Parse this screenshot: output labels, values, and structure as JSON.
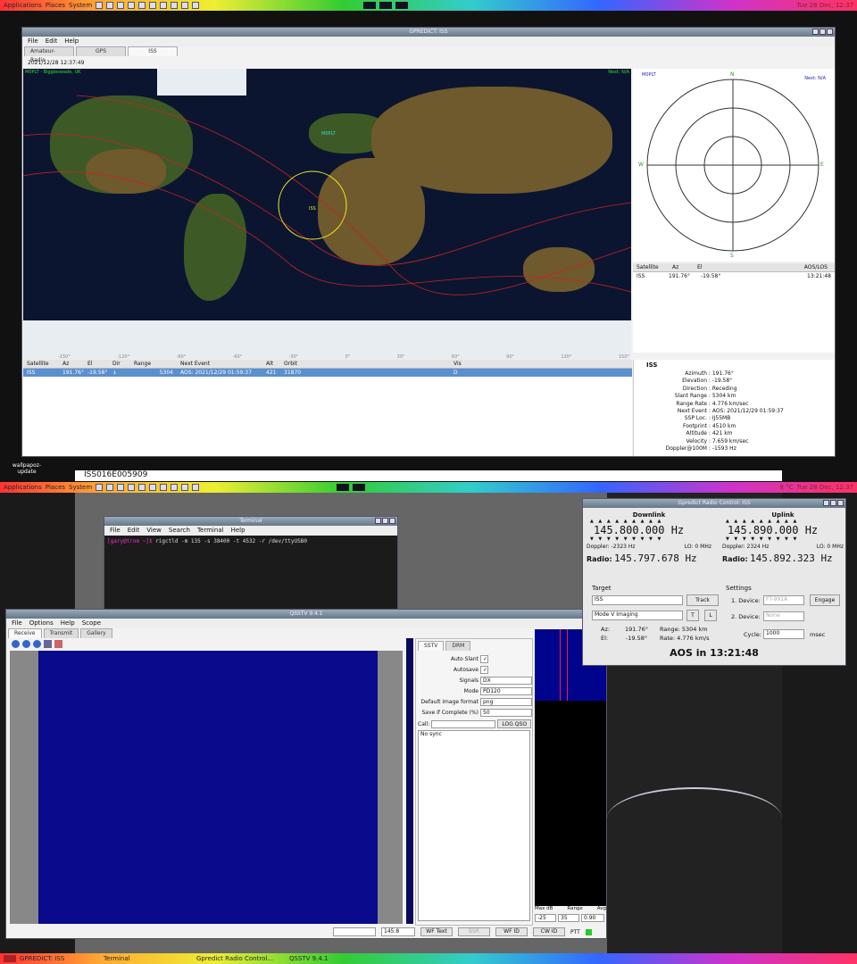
{
  "top_panel": {
    "apps": "Applications",
    "places": "Places",
    "system": "System",
    "clock": "Tue 28 Dec, 12:37"
  },
  "bottom_panel": {
    "apps": "Applications",
    "places": "Places",
    "system": "System",
    "temp": "8 °C",
    "clock": "Tue 28 Dec, 12:37"
  },
  "desktop": {
    "icon_label": "wallpapoz-update",
    "overlay_title": "ISS016E005909"
  },
  "gpredict": {
    "title": "GPREDICT: ISS",
    "menu": [
      "File",
      "Edit",
      "Help"
    ],
    "tabs": [
      "Amateur-Radio",
      "GPS",
      "ISS"
    ],
    "datetime": "2021/12/28 12:37:49",
    "map": {
      "qth": "M0PLT - Biggleswade, UK",
      "next": "Next: N/A",
      "station": "M0PLT",
      "sat": "ISS",
      "lon_ticks": [
        "-150°",
        "-120°",
        "-90°",
        "-60°",
        "-30°",
        "0°",
        "30°",
        "60°",
        "90°",
        "120°",
        "150°"
      ],
      "lat_ticks": [
        "60°",
        "30°",
        "0°",
        "-30°",
        "-60°"
      ]
    },
    "polar": {
      "qth": "M0PLT",
      "next": "Next: N/A",
      "N": "N",
      "S": "S",
      "E": "E",
      "W": "W"
    },
    "polar_table": {
      "headers": [
        "Satellite",
        "Az",
        "El",
        "AOS/LOS"
      ],
      "row": [
        "ISS",
        "191.76°",
        "-19.58°",
        "13:21:48"
      ]
    },
    "list": {
      "headers": [
        "Satellite",
        "Az",
        "El",
        "Dir",
        "Range",
        "Next Event",
        "Alt",
        "Orbit",
        "Vis"
      ],
      "row": [
        "ISS",
        "191.76°",
        "-19.58°",
        "↓",
        "5304",
        "AOS: 2021/12/29 01:59:37",
        "421",
        "31870",
        "D"
      ]
    },
    "details": {
      "title": "ISS",
      "rows": [
        [
          "Azimuth",
          "191.76°"
        ],
        [
          "Elevation",
          "-19.58°"
        ],
        [
          "Direction",
          "Receding"
        ],
        [
          "Slant Range",
          "5304 km"
        ],
        [
          "Range Rate",
          "4.776 km/sec"
        ],
        [
          "Next Event",
          "AOS: 2021/12/29 01:59:37"
        ],
        [
          "SSP Loc.",
          "IJ55MB"
        ],
        [
          "Footprint",
          "4510 km"
        ],
        [
          "Altitude",
          "421 km"
        ],
        [
          "Velocity",
          "7.659 km/sec"
        ],
        [
          "Doppler@100M",
          "-1593 Hz"
        ]
      ]
    }
  },
  "terminal": {
    "title": "Terminal",
    "menu": [
      "File",
      "Edit",
      "View",
      "Search",
      "Terminal",
      "Help"
    ],
    "prompt": "[gary@trom ~]$",
    "command": " rigctld -m 135 -s 38400 -t 4532 -r /dev/ttyUSB0"
  },
  "qsstv": {
    "title": "QSSTV 9.4.1",
    "menu": [
      "File",
      "Options",
      "Help",
      "Scope"
    ],
    "tabs": [
      "Receive",
      "Transmit",
      "Gallery"
    ],
    "side_tabs": [
      "SSTV",
      "DRM"
    ],
    "settings": [
      [
        "Auto Slant",
        "✓"
      ],
      [
        "Autosave",
        "✓"
      ],
      [
        "Signals",
        "DX"
      ],
      [
        "Mode",
        "PD120"
      ],
      [
        "Default image format",
        "png"
      ],
      [
        "Save if Complete (%)",
        "50"
      ]
    ],
    "call_label": "Call:",
    "log_qso": "LOG QSO",
    "status": "No sync",
    "freq": "145.8",
    "wf_text": "WF Text",
    "bsr": "BSR",
    "wf_id": "WF ID",
    "cw_id": "CW ID",
    "ptt": "PTT",
    "scope": {
      "max_db_label": "Max dB",
      "range_label": "Range",
      "avg_label": "Avg",
      "max_db": "-25",
      "range": "35",
      "avg": "0.90"
    }
  },
  "radio": {
    "title": "Gpredict Radio Control: ISS",
    "downlink": {
      "title": "Downlink",
      "freq": "145.800.000 Hz",
      "doppler": "Doppler: -2323 Hz",
      "lo": "LO: 0 MHz",
      "radio_label": "Radio:",
      "radio": "145.797.678 Hz"
    },
    "uplink": {
      "title": "Uplink",
      "freq": "145.890.000 Hz",
      "doppler": "Doppler: 2324 Hz",
      "lo": "LO: 0 MHz",
      "radio_label": "Radio:",
      "radio": "145.892.323 Hz"
    },
    "target": "Target",
    "sat": "ISS",
    "track": "Track",
    "mode": "Mode V Imaging",
    "t": "T",
    "l": "L",
    "az": "Az:",
    "az_val": "191.76°",
    "el": "El:",
    "el_val": "-19.58°",
    "range": "Range: 5304 km",
    "rate": "Rate: 4.776 km/s",
    "settings": "Settings",
    "dev1_label": "1. Device:",
    "dev1": "FT-991A",
    "engage": "Engage",
    "dev2_label": "2. Device:",
    "dev2": "None",
    "cycle_label": "Cycle:",
    "cycle": "1000",
    "msec": "msec",
    "aos": "AOS in 13:21:48"
  },
  "taskbar": [
    "GPREDICT: ISS",
    "Terminal",
    "Gpredict Radio Control...",
    "QSSTV 9.4.1"
  ]
}
